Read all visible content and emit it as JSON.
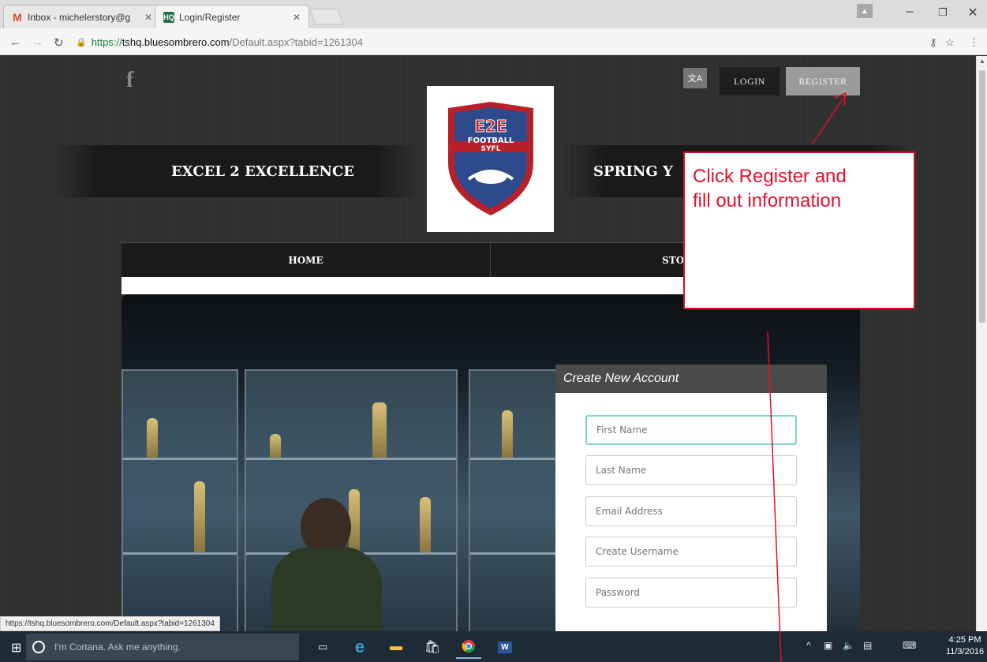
{
  "browser": {
    "tabs": [
      {
        "title": "Inbox - michelerstory@g",
        "active": false
      },
      {
        "title": "Login/Register",
        "active": true
      }
    ],
    "url": {
      "scheme": "https://",
      "host": "tshq.bluesombrero.com",
      "path": "/Default.aspx?tabid=1261304"
    },
    "status_url": "https://tshq.bluesombrero.com/Default.aspx?tabid=1261304"
  },
  "site": {
    "login_label": "LOGIN",
    "register_label": "REGISTER",
    "band_left": "EXCEL 2 EXCELLENCE",
    "band_right": "SPRING Y",
    "logo": {
      "line1": "E2E",
      "line2": "FOOTBALL",
      "line3": "SYFL"
    },
    "nav": [
      {
        "label": "HOME"
      },
      {
        "label": "STOI"
      }
    ]
  },
  "form": {
    "header": "Create New Account",
    "fields": [
      {
        "placeholder": "First Name"
      },
      {
        "placeholder": "Last Name"
      },
      {
        "placeholder": "Email Address"
      },
      {
        "placeholder": "Create Username"
      },
      {
        "placeholder": "Password"
      }
    ]
  },
  "annotation": {
    "line1": "Click Register and",
    "line2": "fill out information",
    "color": "#e0102c"
  },
  "taskbar": {
    "search_placeholder": "I'm Cortana. Ask me anything.",
    "time": "4:25 PM",
    "date": "11/3/2016"
  }
}
